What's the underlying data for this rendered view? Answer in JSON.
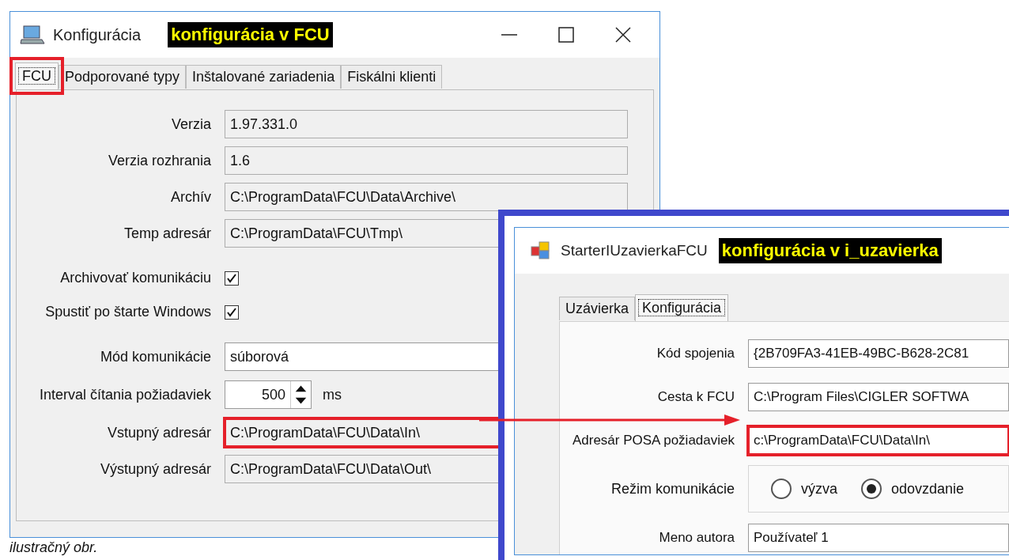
{
  "windows": [
    {
      "title": "Konfigurácia",
      "annotation": "konfigurácia v FCU",
      "controls": true,
      "tabs": [
        {
          "label": "FCU",
          "selected": true,
          "highlighted": true
        },
        {
          "label": "Podporované typy",
          "selected": false,
          "highlighted": false
        },
        {
          "label": "Inštalované zariadenia",
          "selected": false,
          "highlighted": false
        },
        {
          "label": "Fiskálni klienti",
          "selected": false,
          "highlighted": false
        }
      ],
      "groups": [
        [
          {
            "kind": "field",
            "label": "Verzia",
            "value": "1.97.331.0",
            "disabled": true,
            "highlighted": false
          },
          {
            "kind": "field",
            "label": "Verzia rozhrania",
            "value": "1.6",
            "disabled": true,
            "highlighted": false
          },
          {
            "kind": "field",
            "label": "Archív",
            "value": "C:\\ProgramData\\FCU\\Data\\Archive\\",
            "disabled": true,
            "highlighted": false
          },
          {
            "kind": "field",
            "label": "Temp adresár",
            "value": "C:\\ProgramData\\FCU\\Tmp\\",
            "disabled": true,
            "highlighted": false
          }
        ],
        [
          {
            "kind": "checkbox",
            "label": "Archivovať komunikáciu",
            "checked": true
          },
          {
            "kind": "checkbox",
            "label": "Spustiť po štarte Windows",
            "checked": true
          }
        ],
        [
          {
            "kind": "field",
            "label": "Mód komunikácie",
            "value": "súborová",
            "disabled": false,
            "highlighted": false
          },
          {
            "kind": "spinner",
            "label": "Interval čítania požiadaviek",
            "value": "500",
            "unit": "ms"
          },
          {
            "kind": "field",
            "label": "Vstupný adresár",
            "value": "C:\\ProgramData\\FCU\\Data\\In\\",
            "disabled": true,
            "highlighted": true
          },
          {
            "kind": "field",
            "label": "Výstupný adresár",
            "value": "C:\\ProgramData\\FCU\\Data\\Out\\",
            "disabled": true,
            "highlighted": false
          }
        ]
      ]
    },
    {
      "title": "StarterIUzavierkaFCU",
      "annotation": "konfigurácia v i_uzavierka",
      "controls": false,
      "tabs": [
        {
          "label": "Uzávierka",
          "selected": false,
          "highlighted": false
        },
        {
          "label": "Konfigurácia",
          "selected": true,
          "highlighted": false
        }
      ],
      "groups": [
        [
          {
            "kind": "field",
            "label": "Kód spojenia",
            "value": "{2B709FA3-41EB-49BC-B628-2C81",
            "disabled": false,
            "highlighted": false
          },
          {
            "kind": "field",
            "label": "Cesta k FCU",
            "value": "C:\\Program Files\\CIGLER SOFTWA",
            "disabled": false,
            "highlighted": false
          },
          {
            "kind": "field",
            "label": "Adresár POSA požiadaviek",
            "value": "c:\\ProgramData\\FCU\\Data\\In\\",
            "disabled": false,
            "highlighted": true
          },
          {
            "kind": "radio",
            "label": "Režim komunikácie",
            "options": [
              {
                "label": "výzva",
                "selected": false
              },
              {
                "label": "odovzdanie",
                "selected": true
              }
            ]
          },
          {
            "kind": "field",
            "label": "Meno autora",
            "value": "Používateľ 1",
            "disabled": false,
            "highlighted": false
          }
        ]
      ]
    }
  ],
  "caption": "ilustračný obr."
}
